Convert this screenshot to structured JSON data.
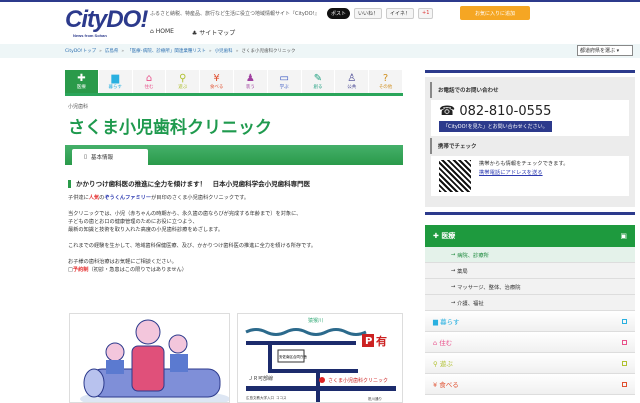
{
  "header": {
    "logo": "CityDO!",
    "logo_sub": "News from Sohan",
    "tagline": "ふるさと納税、特産品、旅行など生活に役立つ地域情報サイト『CityDO!』",
    "nav": [
      "HOME",
      "サイトマップ"
    ],
    "social": [
      "ポスト",
      "いいね！",
      "イイネ！",
      "+1"
    ],
    "favorite": "お気に入りに追加"
  },
  "breadcrumb": {
    "items": [
      "CityDO!トップ",
      "広島県",
      "「医療･病院、診療所」関連業種リスト",
      "小児歯科"
    ],
    "current": "さくま小児歯科クリニック",
    "prefecture_select": "都道府県を選ぶ"
  },
  "tabs": [
    {
      "label": "医療",
      "icon": "✚",
      "color": "#fff"
    },
    {
      "label": "暮らす",
      "icon": "▆",
      "color": "#2ab0e0"
    },
    {
      "label": "住む",
      "icon": "⌂",
      "color": "#e8508a"
    },
    {
      "label": "遊ぶ",
      "icon": "⚲",
      "color": "#b0c030"
    },
    {
      "label": "食べる",
      "icon": "¥",
      "color": "#e05030"
    },
    {
      "label": "装う",
      "icon": "♟",
      "color": "#a040a0"
    },
    {
      "label": "学ぶ",
      "icon": "▭",
      "color": "#3050c0"
    },
    {
      "label": "創る",
      "icon": "✎",
      "color": "#20a080"
    },
    {
      "label": "公共",
      "icon": "♙",
      "color": "#404090"
    },
    {
      "label": "その他",
      "icon": "?",
      "color": "#d09020"
    }
  ],
  "page": {
    "category": "小児歯科",
    "title": "さくま小児歯科クリニック",
    "section_tab": "基本情報",
    "heading": "かかりつけ歯科医の推進に全力を傾けます！　日本小児歯科学会小児歯科専門医",
    "p1_a": "子供達に",
    "p1_red": "人気",
    "p1_b": "の",
    "p1_blue": "ぞうくんファミリー",
    "p1_c": "が目印のさくま小児歯科クリニックです。",
    "p2": [
      "当クリニックでは、小児（赤ちゃんの時期から、永久歯の歯ならびが完成する年齢まで）を対象に、",
      "子どもの歯とお口の健康管理のためにお役に立つよう、",
      "最新の知識と技術を取り入れた高度の小児歯科診療をめざします。"
    ],
    "p3": "これまでの経験を生かして、地域歯科保健医療、及び、かかりつけ歯科医の推進に全力を傾ける所存です。",
    "p4": "お子様の歯科治療はお気軽にご相談ください。",
    "reserve_red": "予約制",
    "reserve_note": "（初診・急患はこの限りではありません）",
    "map": {
      "river": "猿猴川",
      "parking": "有",
      "jr": "ＪＲ可部線",
      "clinic": "さくま小児歯科クリニック",
      "school": "安佐南区合同庁舎",
      "label2": "広島文教大学入口",
      "coco": "ココス",
      "road": "祇川通り"
    }
  },
  "sidebar": {
    "phone_head": "お電話でのお問い合わせ",
    "phone": "082-810-0555",
    "phone_note": "「CityDO!を見た」とお問い合わせください。",
    "mobile_head": "携帯でチェック",
    "mobile_text": "携帯からも情報をチェックできます。",
    "mobile_link": "携帯電話にアドレスを送る"
  },
  "menu": {
    "head": "医療",
    "subs": [
      "病院、診療所",
      "薬局",
      "マッサージ、整体、治療院",
      "介護、福祉"
    ],
    "items": [
      {
        "label": "暮らす",
        "color": "#2ab0e0",
        "icon": "▆"
      },
      {
        "label": "住む",
        "color": "#e8508a",
        "icon": "⌂"
      },
      {
        "label": "遊ぶ",
        "color": "#b0c030",
        "icon": "⚲"
      },
      {
        "label": "食べる",
        "color": "#e05030",
        "icon": "¥"
      }
    ]
  }
}
